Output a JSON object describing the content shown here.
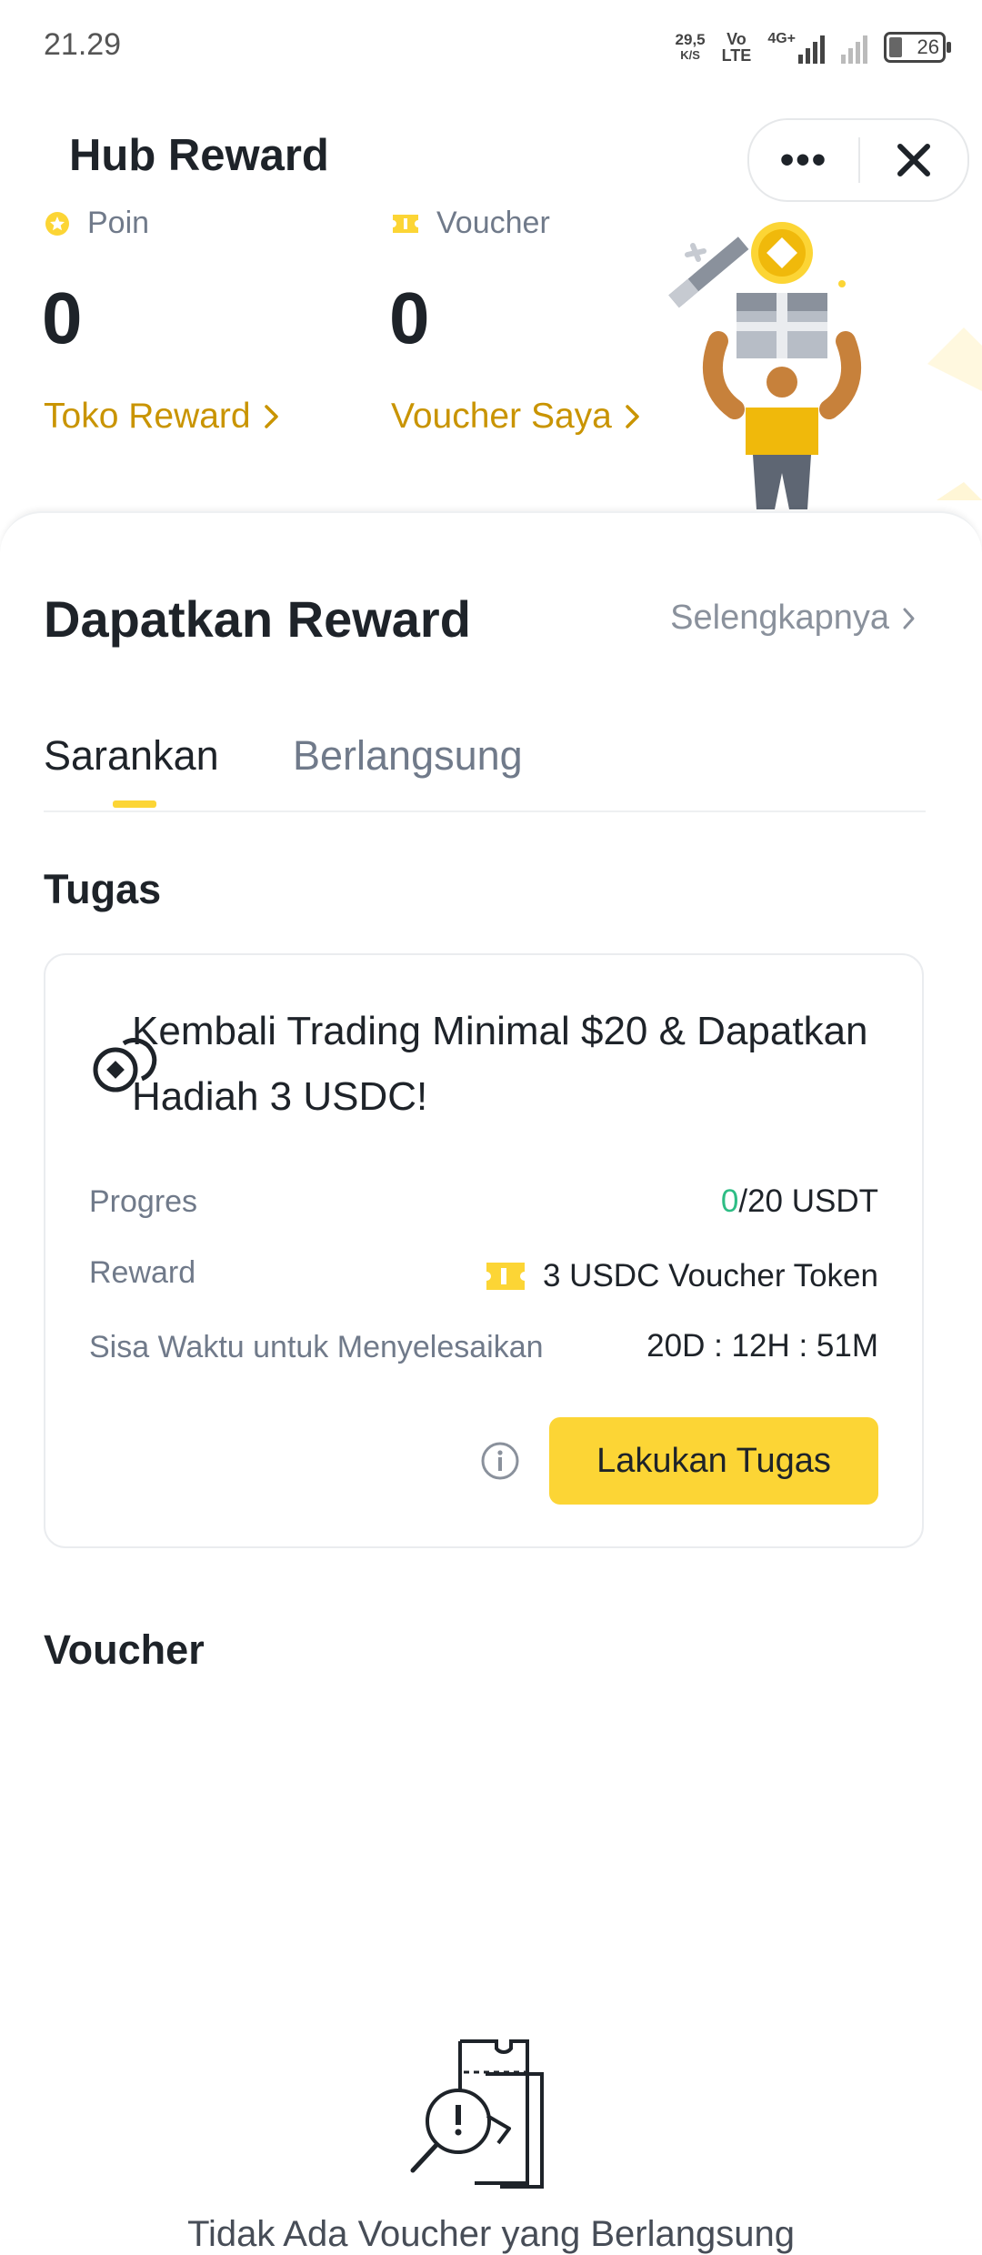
{
  "status_bar": {
    "time": "21.29",
    "net_speed_value": "29,5",
    "net_speed_unit": "K/S",
    "volte_top": "Vo",
    "volte_bottom": "LTE",
    "signal_type": "4G+",
    "battery": "26"
  },
  "header": {
    "title": "Hub Reward",
    "more_label": "•••"
  },
  "summary": {
    "points_label": "Poin",
    "points_value": "0",
    "points_link": "Toko Reward",
    "voucher_label": "Voucher",
    "voucher_value": "0",
    "voucher_link": "Voucher Saya"
  },
  "rewards": {
    "title": "Dapatkan Reward",
    "see_more": "Selengkapnya",
    "tabs": [
      {
        "label": "Sarankan",
        "active": true
      },
      {
        "label": "Berlangsung",
        "active": false
      }
    ]
  },
  "tasks": {
    "section_title": "Tugas",
    "card": {
      "title": "Kembali Trading Minimal $20 & Dapatkan Hadiah 3 USDC!",
      "progress_label": "Progres",
      "progress_current": "0",
      "progress_total": "/20 USDT",
      "reward_label": "Reward",
      "reward_value": "3 USDC Voucher Token",
      "time_label": "Sisa Waktu untuk Menyelesaikan",
      "time_value": "20D : 12H : 51M",
      "button_label": "Lakukan Tugas"
    }
  },
  "voucher": {
    "section_title": "Voucher",
    "empty_text": "Tidak Ada Voucher yang Berlangsung"
  },
  "colors": {
    "accent": "#fcd535",
    "link_gold": "#c99400",
    "progress_green": "#2ebd85",
    "text_primary": "#1e2329",
    "text_secondary": "#707a8a"
  },
  "icons": [
    "star-coin-icon",
    "ticket-icon",
    "chevron-right-icon",
    "close-icon",
    "coins-icon",
    "info-icon",
    "voucher-search-icon"
  ]
}
